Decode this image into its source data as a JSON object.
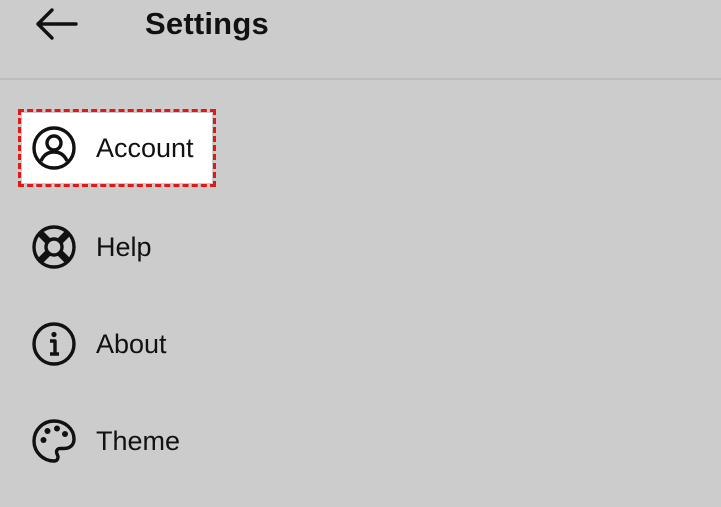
{
  "header": {
    "title": "Settings",
    "back_icon": "arrow-left-icon"
  },
  "menu": {
    "items": [
      {
        "label": "Account",
        "icon": "account-icon",
        "selected": true
      },
      {
        "label": "Help",
        "icon": "lifebuoy-icon",
        "selected": false
      },
      {
        "label": "About",
        "icon": "info-icon",
        "selected": false
      },
      {
        "label": "Theme",
        "icon": "palette-icon",
        "selected": false
      }
    ]
  },
  "colors": {
    "background": "#cccccc",
    "selected_bg": "#ffffff",
    "highlight_border": "#e01818",
    "text": "#111111"
  }
}
